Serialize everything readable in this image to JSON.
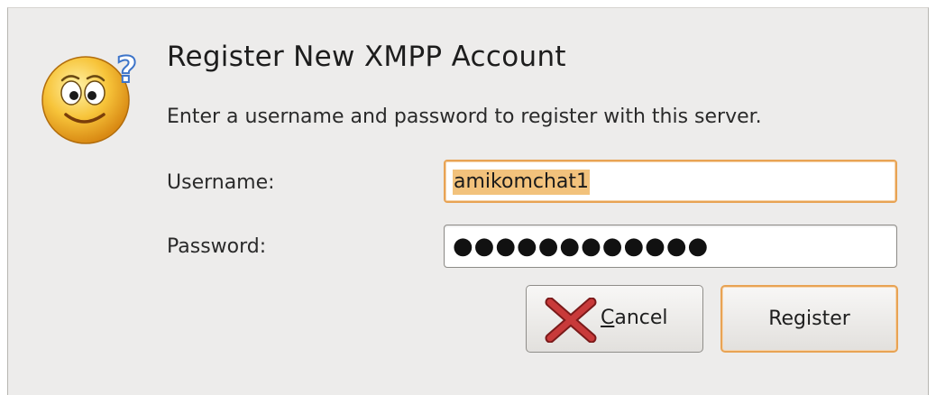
{
  "dialog": {
    "title": "Register New XMPP Account",
    "subtitle": "Enter a username and password to register with this server.",
    "icon": "smiley-question-icon"
  },
  "form": {
    "username_label": "Username:",
    "username_value": "amikomchat1",
    "password_label": "Password:",
    "password_masked": "●●●●●●●●●●●●"
  },
  "buttons": {
    "cancel_mnemonic": "C",
    "cancel_rest": "ancel",
    "cancel_icon": "red-x-icon",
    "register_label": "Register"
  },
  "colors": {
    "focus_accent": "#e8a354",
    "selection": "#f2c27c",
    "dialog_bg": "#edeceb"
  }
}
